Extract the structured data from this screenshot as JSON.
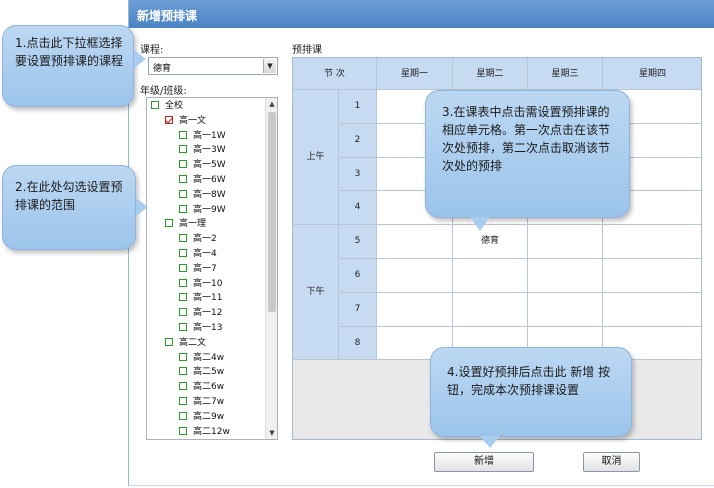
{
  "dialog": {
    "title": "新增预排课"
  },
  "course_label": "课程:",
  "course_select": {
    "value": "德育"
  },
  "grade_label": "年级/班级:",
  "schedule_label": "预排课",
  "tree": [
    {
      "label": "全校",
      "level": 0,
      "checked": false
    },
    {
      "label": "高一文",
      "level": 1,
      "checked": true
    },
    {
      "label": "高一1W",
      "level": 2,
      "checked": false
    },
    {
      "label": "高一3W",
      "level": 2,
      "checked": false
    },
    {
      "label": "高一5W",
      "level": 2,
      "checked": false
    },
    {
      "label": "高一6W",
      "level": 2,
      "checked": false
    },
    {
      "label": "高一8W",
      "level": 2,
      "checked": false
    },
    {
      "label": "高一9W",
      "level": 2,
      "checked": false
    },
    {
      "label": "高一理",
      "level": 1,
      "checked": false
    },
    {
      "label": "高一2",
      "level": 2,
      "checked": false
    },
    {
      "label": "高一4",
      "level": 2,
      "checked": false
    },
    {
      "label": "高一7",
      "level": 2,
      "checked": false
    },
    {
      "label": "高一10",
      "level": 2,
      "checked": false
    },
    {
      "label": "高一11",
      "level": 2,
      "checked": false
    },
    {
      "label": "高一12",
      "level": 2,
      "checked": false
    },
    {
      "label": "高一13",
      "level": 2,
      "checked": false
    },
    {
      "label": "高二文",
      "level": 1,
      "checked": false
    },
    {
      "label": "高二4w",
      "level": 2,
      "checked": false
    },
    {
      "label": "高二5w",
      "level": 2,
      "checked": false
    },
    {
      "label": "高二6w",
      "level": 2,
      "checked": false
    },
    {
      "label": "高二7w",
      "level": 2,
      "checked": false
    },
    {
      "label": "高二9w",
      "level": 2,
      "checked": false
    },
    {
      "label": "高二12w",
      "level": 2,
      "checked": false
    }
  ],
  "grid": {
    "period_header": "节  次",
    "days": [
      "星期一",
      "星期二",
      "星期三",
      "星期四"
    ],
    "morning": "上午",
    "afternoon": "下午",
    "periods": [
      "1",
      "2",
      "3",
      "4",
      "5",
      "6",
      "7",
      "8"
    ],
    "filled_cell": {
      "period": "5",
      "day": "星期二",
      "text": "德育"
    }
  },
  "buttons": {
    "add": "新增",
    "cancel": "取消"
  },
  "callouts": {
    "c1": "1.点击此下拉框选择要设置预排课的课程",
    "c2": "2.在此处勾选设置预排课的范围",
    "c3": "3.在课表中点击需设置预排课的相应单元格。第一次点击在该节次处预排，第二次点击取消该节次处的预排",
    "c4": "4.设置好预排后点击此 新增 按钮，完成本次预排课设置"
  },
  "colors": {
    "title_bar": "#4a83c4",
    "header_fill": "#c6daf1",
    "callout_fill": "#a9cdee"
  }
}
